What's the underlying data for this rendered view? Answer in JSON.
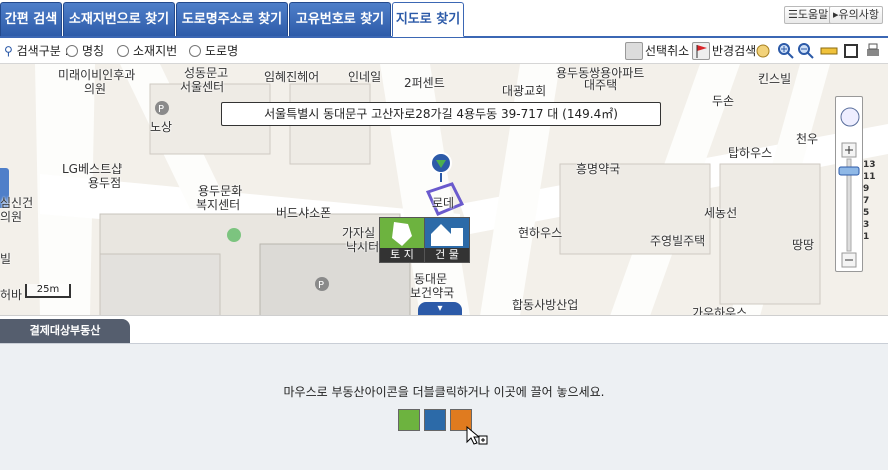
{
  "tabs": [
    {
      "label": "간편 검색"
    },
    {
      "label": "소재지번으로 찾기"
    },
    {
      "label": "도로명주소로 찾기"
    },
    {
      "label": "고유번호로 찾기"
    },
    {
      "label": "지도로 찾기"
    }
  ],
  "top_buttons": {
    "help": "도움말",
    "notice": "유의사항"
  },
  "search": {
    "label": "검색구분 :",
    "options": [
      "명칭",
      "소재지번",
      "도로명"
    ]
  },
  "tools": {
    "deselect": "선택취소",
    "radius": "반경검색"
  },
  "map": {
    "address": "서울특별시 동대문구 고산자로28가길 4용두동 39-717 대 (149.4㎡)",
    "labels": [
      "미래이비인후과",
      "의원",
      "성동문고",
      "서울센터",
      "임혜진헤어",
      "인네일",
      "2퍼센트",
      "용두동쌍용아파트",
      "대주택",
      "두손",
      "킨스빌",
      "대광교회",
      "노상",
      "LG베스트샵",
      "용두점",
      "흥명약국",
      "탑하우스",
      "천우",
      "용두문화",
      "복지센터",
      "버드샤소폰",
      "로데",
      "세농선",
      "가자실",
      "낙시터",
      "현하우스",
      "주영빌주택",
      "땅땅",
      "동대문",
      "보건약국",
      "합동사방산업",
      "가우하우스",
      "심신건",
      "의원",
      "빌",
      "허바"
    ],
    "poi_land": "토 지",
    "poi_building": "건 물",
    "scale": "25m",
    "zoom_levels": [
      "13",
      "11",
      "9",
      "7",
      "5",
      "3",
      "1"
    ]
  },
  "bottom": {
    "tab": "결제대상부동산",
    "hint": "마우스로 부동산아이콘을 더블클릭하거나 이곳에 끌어 놓으세요."
  },
  "colors": {
    "tab_blue": "#3b67b4",
    "poi_land": "#6db33f",
    "poi_building": "#2c6aa8",
    "parcel": "#6a5acd"
  }
}
